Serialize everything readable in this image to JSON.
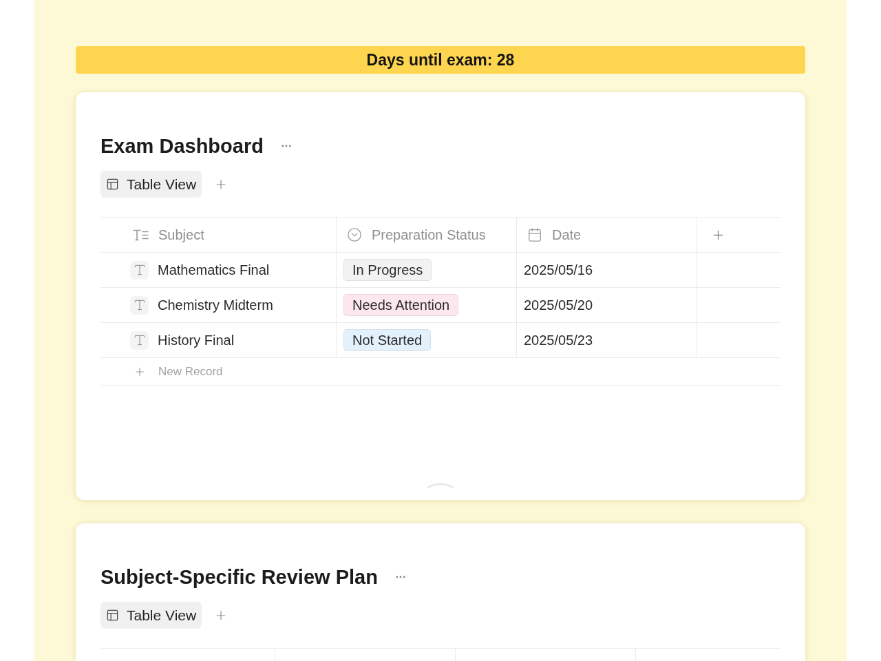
{
  "countdown_banner": {
    "text": "Days until exam: 28"
  },
  "databases": [
    {
      "title": "Exam Dashboard",
      "views": [
        {
          "label": "Table View",
          "selected": true
        }
      ],
      "table": {
        "columns": [
          {
            "label": "Subject",
            "kind": "text"
          },
          {
            "label": "Preparation Status",
            "kind": "status"
          },
          {
            "label": "Date",
            "kind": "date"
          }
        ],
        "rows": [
          {
            "cells": [
              "Mathematics Final",
              {
                "label": "In Progress",
                "color": "#f2f2f2"
              },
              "2025/05/16"
            ]
          },
          {
            "cells": [
              "Chemistry Midterm",
              {
                "label": "Needs Attention",
                "color": "#fde7ee"
              },
              "2025/05/20"
            ]
          },
          {
            "cells": [
              "History Final",
              {
                "label": "Not Started",
                "color": "#e3f1fd"
              },
              "2025/05/23"
            ]
          }
        ],
        "new_record": "New Record"
      }
    },
    {
      "title": "Subject-Specific Review Plan",
      "views": [
        {
          "label": "Table View",
          "selected": true
        }
      ]
    }
  ]
}
